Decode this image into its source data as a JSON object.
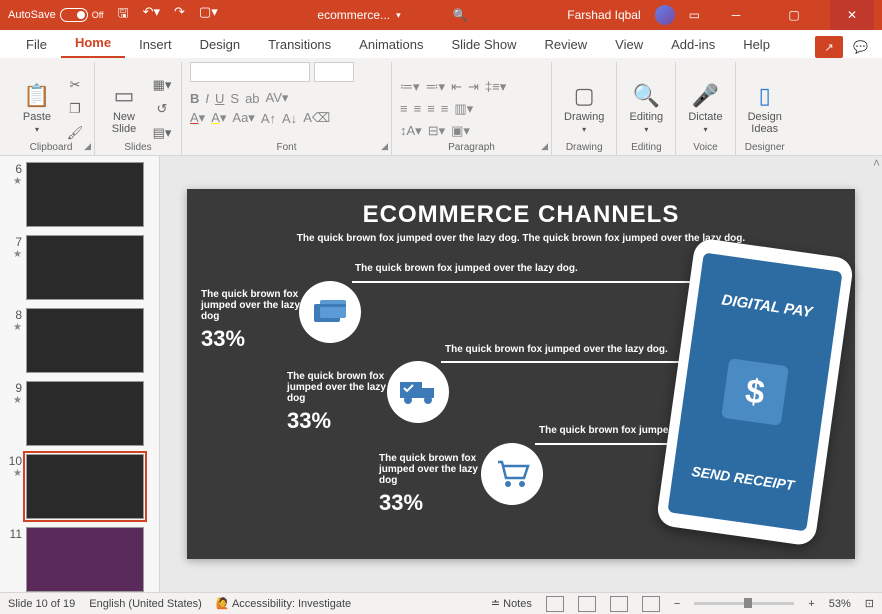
{
  "titlebar": {
    "autosave_label": "AutoSave",
    "autosave_state": "Off",
    "filename": "ecommerce...",
    "username": "Farshad Iqbal"
  },
  "tabs": [
    "File",
    "Home",
    "Insert",
    "Design",
    "Transitions",
    "Animations",
    "Slide Show",
    "Review",
    "View",
    "Add-ins",
    "Help"
  ],
  "active_tab": "Home",
  "ribbon": {
    "clipboard": {
      "label": "Clipboard",
      "paste": "Paste"
    },
    "slides": {
      "label": "Slides",
      "new_slide": "New\nSlide"
    },
    "font": {
      "label": "Font",
      "family_placeholder": "",
      "size_placeholder": ""
    },
    "paragraph": {
      "label": "Paragraph"
    },
    "drawing": {
      "label": "Drawing",
      "btn": "Drawing"
    },
    "editing": {
      "label": "Editing",
      "btn": "Editing"
    },
    "voice": {
      "label": "Voice",
      "btn": "Dictate"
    },
    "designer": {
      "label": "Designer",
      "btn": "Design\nIdeas"
    }
  },
  "thumbnails": [
    {
      "num": 6,
      "star": true
    },
    {
      "num": 7,
      "star": true
    },
    {
      "num": 8,
      "star": true
    },
    {
      "num": 9,
      "star": true
    },
    {
      "num": 10,
      "star": true,
      "active": true
    },
    {
      "num": 11,
      "purple": true
    }
  ],
  "slide": {
    "title": "ECOMMERCE CHANNELS",
    "subtitle": "The quick brown fox jumped over the lazy dog. The quick brown fox jumped over the lazy dog.",
    "conn1": "The quick brown fox jumped over the lazy dog.",
    "conn2": "The quick brown fox jumped over the lazy dog.",
    "conn3": "The quick brown fox jumped.",
    "stat_text": "The quick brown fox jumped over the lazy dog",
    "stat_pct": "33%",
    "phone_top": "DIGITAL PAY",
    "phone_dollar": "$",
    "phone_bottom": "SEND RECEIPT"
  },
  "status": {
    "slide_count": "Slide 10 of 19",
    "language": "English (United States)",
    "accessibility": "Accessibility: Investigate",
    "notes": "Notes",
    "zoom": "53%"
  }
}
